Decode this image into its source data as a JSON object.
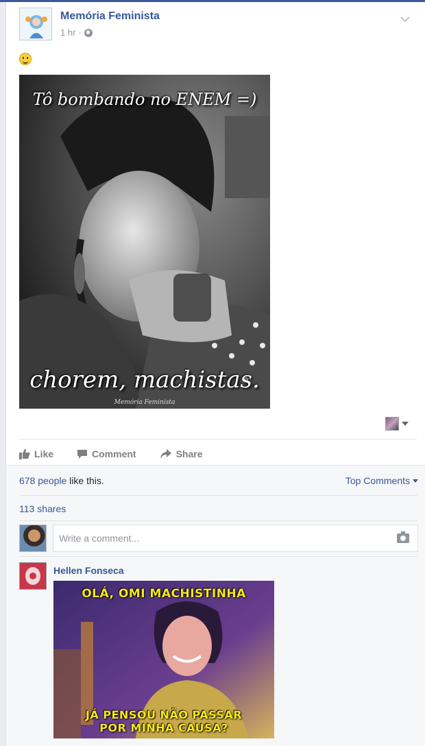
{
  "post": {
    "page_name": "Memória Feminista",
    "time": "1 hr",
    "separator": "·",
    "privacy_icon": "globe-icon",
    "options_icon": "chevron-down-icon",
    "emoji": "slightly-smiling-face",
    "image": {
      "top_caption": "Tô bombando no ENEM =)",
      "bottom_caption": "chorem, machistas.",
      "watermark": "Memória Feminista"
    }
  },
  "actions": {
    "like_label": "Like",
    "comment_label": "Comment",
    "share_label": "Share"
  },
  "feedback": {
    "likes_count_text": "678 people",
    "likes_suffix": " like this.",
    "sort_label": "Top Comments",
    "shares_text": "113 shares",
    "comment_placeholder": "Write a comment..."
  },
  "comments": [
    {
      "author": "Hellen Fonseca",
      "image_top_text": "OLÁ, OMI MACHISTINHA",
      "image_bottom_line1": "JÁ PENSOU NÃO PASSAR",
      "image_bottom_line2": "POR MINHA CAUSA?"
    }
  ],
  "colors": {
    "link": "#365899",
    "brand_bar": "#3b5998",
    "meme_text": "#f5e71b"
  }
}
